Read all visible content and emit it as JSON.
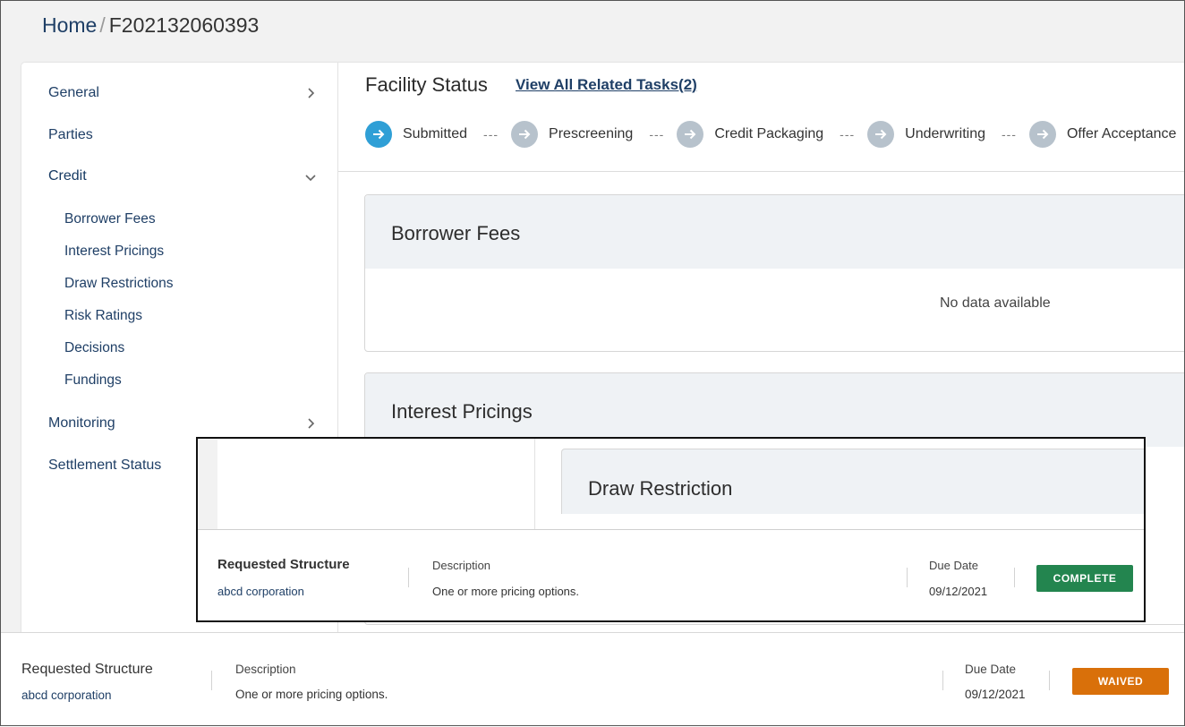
{
  "breadcrumb": {
    "home": "Home",
    "separator": "/",
    "current": "F202132060393"
  },
  "sidebar": {
    "items": [
      {
        "label": "General",
        "chevron": "right"
      },
      {
        "label": "Parties"
      },
      {
        "label": "Credit",
        "chevron": "down"
      },
      {
        "label": "Monitoring",
        "chevron": "right"
      },
      {
        "label": "Settlement Status"
      }
    ],
    "credit_subitems": [
      "Borrower Fees",
      "Interest Pricings",
      "Draw Restrictions",
      "Risk Ratings",
      "Decisions",
      "Fundings"
    ]
  },
  "main": {
    "status_title": "Facility Status",
    "tasks_link": "View All Related Tasks(2)",
    "steps": [
      {
        "label": "Submitted",
        "state": "complete"
      },
      {
        "label": "Prescreening",
        "state": "pending"
      },
      {
        "label": "Credit Packaging",
        "state": "pending"
      },
      {
        "label": "Underwriting",
        "state": "pending"
      },
      {
        "label": "Offer Acceptance",
        "state": "pending"
      }
    ],
    "step_separator": "---",
    "panels": [
      {
        "title": "Borrower Fees",
        "empty_text": "No data available"
      },
      {
        "title": "Interest Pricings"
      }
    ]
  },
  "overlay": {
    "panel_title": "Draw Restriction",
    "task": {
      "title": "Requested Structure",
      "subtitle": "abcd corporation",
      "description_label": "Description",
      "description": "One or more pricing options.",
      "due_label": "Due Date",
      "due_date": "09/12/2021",
      "status": "COMPLETE",
      "status_color": "#23854f"
    }
  },
  "footer_task": {
    "title": "Requested Structure",
    "subtitle": "abcd corporation",
    "description_label": "Description",
    "description": "One or more pricing options.",
    "due_label": "Due Date",
    "due_date": "09/12/2021",
    "status": "WAIVED",
    "status_color": "#d9700a"
  }
}
